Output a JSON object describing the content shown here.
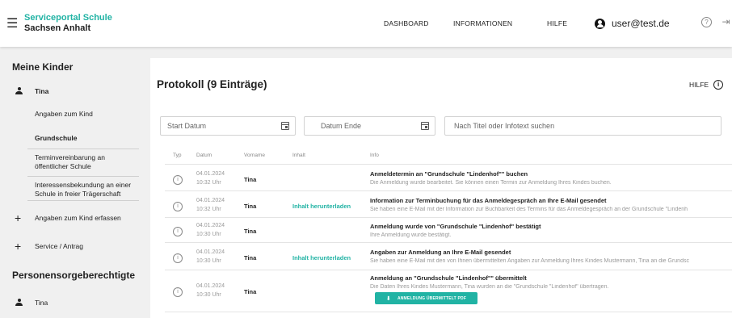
{
  "header": {
    "menu_icon": "hamburger-icon",
    "brand_line1": "Serviceportal Schule",
    "brand_line2": "Sachsen Anhalt",
    "nav": [
      "DASHBOARD",
      "INFORMATIONEN",
      "HILFE"
    ],
    "user": "user@test.de",
    "user_icon": "account-circle-icon",
    "help_icon": "help-circle-icon",
    "logout_icon": "logout-icon"
  },
  "sidebar": {
    "section1": "Meine Kinder",
    "child": "Tina",
    "items": [
      "Angaben zum Kind",
      "Grundschule",
      "Terminvereinbarung an öffentlicher Schule",
      "Interessensbekundung an einer Schule in freier Trägerschaft"
    ],
    "add_child": "Angaben zum Kind erfassen",
    "service": "Service / Antrag",
    "section2": "Personensorgeberechtigte",
    "guardian": "Tina"
  },
  "main": {
    "title": "Protokoll (9 Einträge)",
    "help_label": "HILFE",
    "filters": {
      "start_placeholder": "Start Datum",
      "end_placeholder": "Datum Ende",
      "search_placeholder": "Nach Titel oder Infotext suchen"
    },
    "columns": [
      "Typ",
      "Datum",
      "Vorname",
      "Inhalt",
      "Info"
    ],
    "rows": [
      {
        "date": "04.01.2024",
        "time": "10:32 Uhr",
        "vorname": "Tina",
        "inhalt": "",
        "info_title": "Anmeldetermin an \"Grundschule \"Lindenhof\"\" buchen",
        "info_sub": "Die Anmeldung wurde bearbeitet. Sie können einen Termin zur Anmeldung Ihres Kindes buchen."
      },
      {
        "date": "04.01.2024",
        "time": "10:32 Uhr",
        "vorname": "Tina",
        "inhalt": "Inhalt herunterladen",
        "info_title": "Information zur Terminbuchung für das Anmeldegespräch an Ihre E-Mail gesendet",
        "info_sub": "Sie haben eine E-Mail mit der Information zur Buchbarkeit des Termins für das Anmeldegespräch an der Grundschule \"Lindenh"
      },
      {
        "date": "04.01.2024",
        "time": "10:30 Uhr",
        "vorname": "Tina",
        "inhalt": "",
        "info_title": "Anmeldung wurde von \"Grundschule \"Lindenhof\" bestätigt",
        "info_sub": "Ihre Anmeldung wurde bestätigt."
      },
      {
        "date": "04.01.2024",
        "time": "10:30 Uhr",
        "vorname": "Tina",
        "inhalt": "Inhalt herunterladen",
        "info_title": "Angaben zur Anmeldung an Ihre E-Mail gesendet",
        "info_sub": "Sie haben eine E-Mail mit den von Ihnen übermittelten Angaben zur Anmeldung Ihres Kindes Mustermann, Tina an die Grundsc"
      },
      {
        "date": "04.01.2024",
        "time": "10:30 Uhr",
        "vorname": "Tina",
        "inhalt": "",
        "info_title": "Anmeldung an \"Grundschule \"Lindenhof\"\" übermittelt",
        "info_sub": "Die Daten Ihres Kindes Mustermann, Tina wurden an die \"Grundschule \"Lindenhof\" übertragen."
      }
    ],
    "pdf_button": "ANMELDUNG ÜBERMITTELT PDF"
  }
}
